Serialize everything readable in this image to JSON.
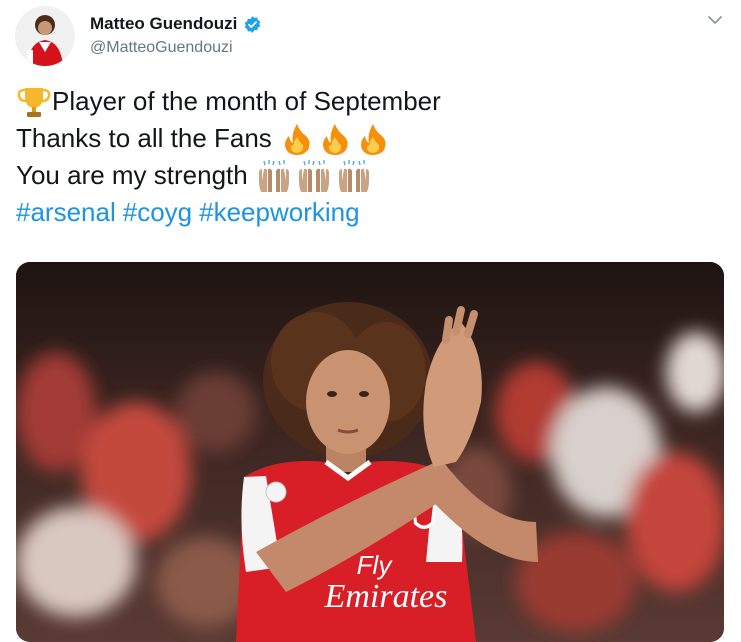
{
  "user": {
    "name": "Matteo Guendouzi",
    "handle": "@MatteoGuendouzi"
  },
  "tweet": {
    "line1": "Player of the month of September",
    "line2": "Thanks to all the Fans",
    "line3": "You are my strength",
    "hashtags": [
      "#arsenal",
      "#coyg",
      "#keepworking"
    ]
  },
  "media": {
    "shirt_sponsor_line1": "Fly",
    "shirt_sponsor_line2": "Emirates"
  },
  "icons": {
    "verified": "verified-badge-icon",
    "caret": "chevron-down-icon",
    "trophy": "trophy-icon",
    "fire": "fire-icon",
    "clap": "raising-hands-icon"
  },
  "colors": {
    "link": "#1b95e0",
    "verified": "#1da1f2",
    "handle": "#657786"
  }
}
